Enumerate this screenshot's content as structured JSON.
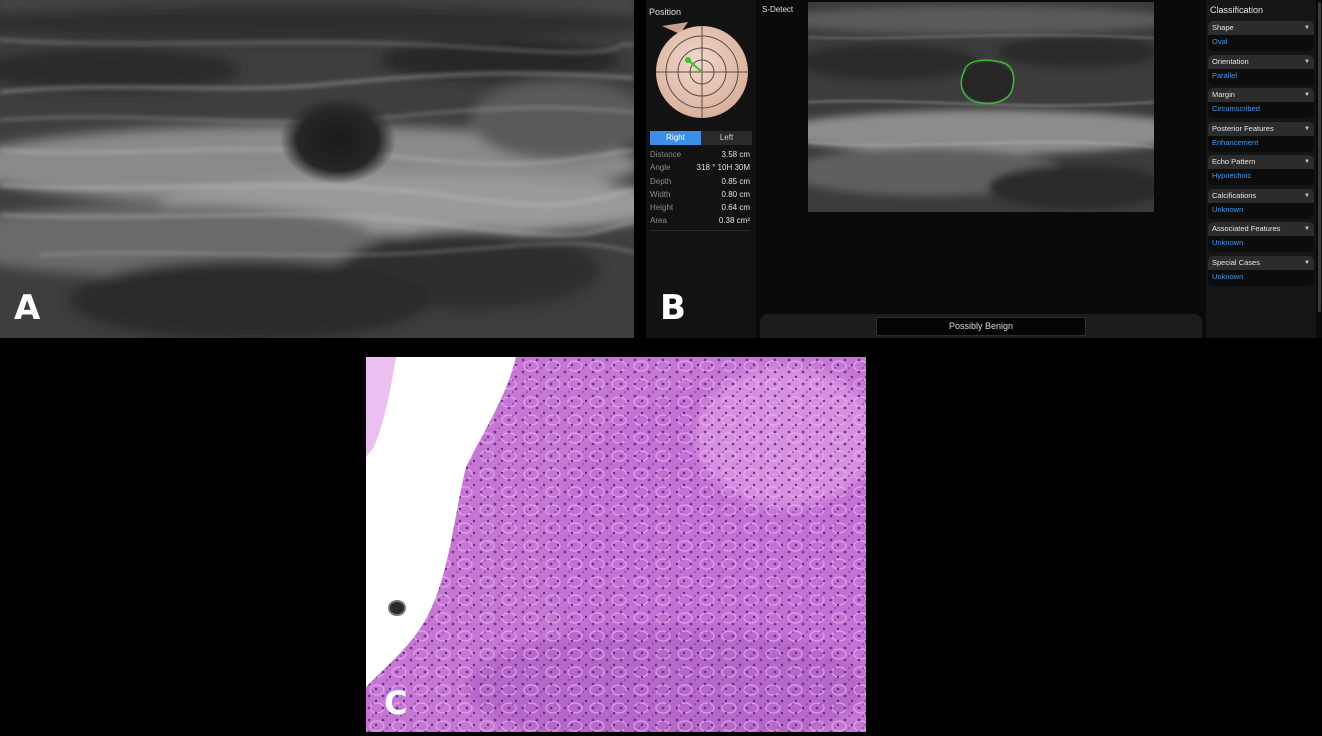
{
  "panels": {
    "a_label": "A",
    "b_label": "B",
    "c_label": "C"
  },
  "position_panel": {
    "title": "Position",
    "side_right": "Right",
    "side_left": "Left",
    "measurements": [
      {
        "label": "Distance",
        "value": "3.58 cm"
      },
      {
        "label": "Angle",
        "value": "318 ° 10H 30M"
      },
      {
        "label": "Depth",
        "value": "0.85 cm"
      },
      {
        "label": "Width",
        "value": "0.80 cm"
      },
      {
        "label": "Height",
        "value": "0.64 cm"
      },
      {
        "label": "Area",
        "value": "0.38 cm²"
      }
    ]
  },
  "sdetect": {
    "title": "S-Detect",
    "result": "Possibly Benign"
  },
  "classification": {
    "title": "Classification",
    "items": [
      {
        "label": "Shape",
        "value": "Oval"
      },
      {
        "label": "Orientation",
        "value": "Parallel"
      },
      {
        "label": "Margin",
        "value": "Circumscribed"
      },
      {
        "label": "Posterior Features",
        "value": "Enhancement"
      },
      {
        "label": "Echo Pattern",
        "value": "Hypoechoic"
      },
      {
        "label": "Calcifications",
        "value": "Unknown"
      },
      {
        "label": "Associated Features",
        "value": "Unknown"
      },
      {
        "label": "Special Cases",
        "value": "Unknown"
      }
    ]
  },
  "colors": {
    "accent_blue": "#3d8ee6",
    "value_blue": "#3f9bf0",
    "lesion_outline": "#39c035",
    "tissue_pink": "#c36fd0"
  }
}
